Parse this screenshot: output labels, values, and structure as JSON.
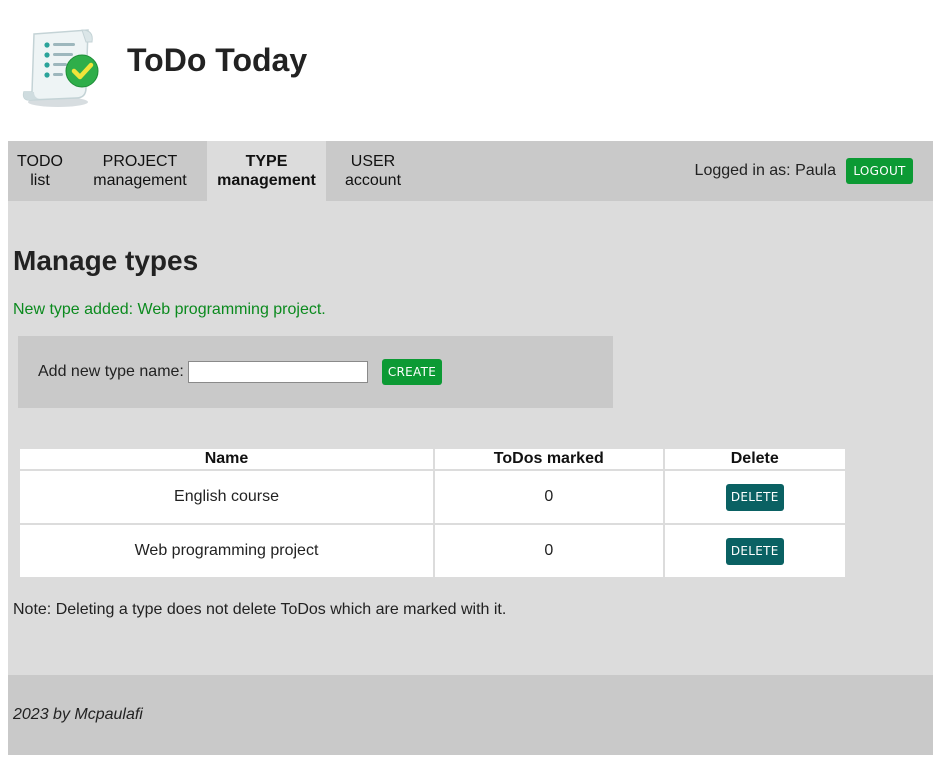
{
  "app": {
    "title": "ToDo Today",
    "logo_icon": "checklist-scroll-icon"
  },
  "nav": {
    "items": [
      {
        "line1": "TODO",
        "line2": "list",
        "active": false
      },
      {
        "line1": "PROJECT",
        "line2": "management",
        "active": false
      },
      {
        "line1": "TYPE",
        "line2": "management",
        "active": true
      },
      {
        "line1": "USER",
        "line2": "account",
        "active": false
      }
    ],
    "logged_in_text": "Logged in as: Paula",
    "logout_label": "LOGOUT"
  },
  "main": {
    "title": "Manage types",
    "success_message": "New type added: Web programming project.",
    "add_form": {
      "label": "Add new type name:",
      "input_value": "",
      "placeholder": "",
      "create_label": "CREATE"
    },
    "table": {
      "headers": [
        "Name",
        "ToDos marked",
        "Delete"
      ],
      "rows": [
        {
          "name": "English course",
          "count": "0",
          "delete_label": "DELETE"
        },
        {
          "name": "Web programming project",
          "count": "0",
          "delete_label": "DELETE"
        }
      ]
    },
    "note": "Note: Deleting a type does not delete ToDos which are marked with it."
  },
  "footer": {
    "text": "2023 by Mcpaulafi"
  },
  "colors": {
    "green_button": "#0c9a34",
    "teal_button": "#0a6163",
    "success_text": "#0b8a1e",
    "nav_background": "#c9c9c9",
    "main_background": "#dcdcdc"
  }
}
